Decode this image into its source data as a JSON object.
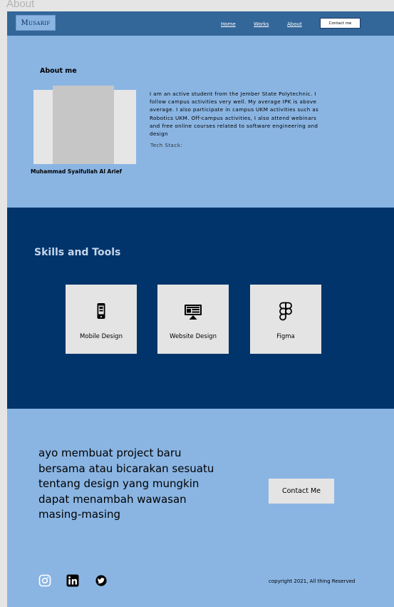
{
  "frame_label": "About",
  "nav": {
    "logo": "Musarif",
    "links": [
      "Home",
      "Works",
      "About"
    ],
    "contact_label": "Contact me"
  },
  "about": {
    "title": "About me",
    "name": "Muhammad Syaifullah Al Arief",
    "bio": "I am an active student from the Jember State Polytechnic. I follow campus activities very well. My average IPK is above average. I also participate in campus UKM activities such as Robotics UKM. Off-campus activities, I also attend webinars and free online courses related to software engineering and design",
    "tech_stack_label": "Tech Stack:"
  },
  "skills": {
    "title": "Skills and Tools",
    "items": [
      {
        "label": "Mobile Design",
        "icon": "mobile-phone-icon"
      },
      {
        "label": "Website Design",
        "icon": "desktop-monitor-icon"
      },
      {
        "label": "Figma",
        "icon": "figma-icon"
      }
    ]
  },
  "cta": {
    "text": "ayo membuat project baru bersama atau bicarakan sesuatu tentang design yang mungkin dapat menambah wawasan masing-masing",
    "button_label": "Contact Me"
  },
  "footer": {
    "social": [
      "instagram-icon",
      "linkedin-icon",
      "twitter-icon"
    ],
    "copyright": "copyright 2021, All thing Reserved"
  },
  "colors": {
    "page_bg": "#8ab5e3",
    "nav_bg": "#336699",
    "skills_bg": "#00346b",
    "card_bg": "#e4e4e4"
  }
}
